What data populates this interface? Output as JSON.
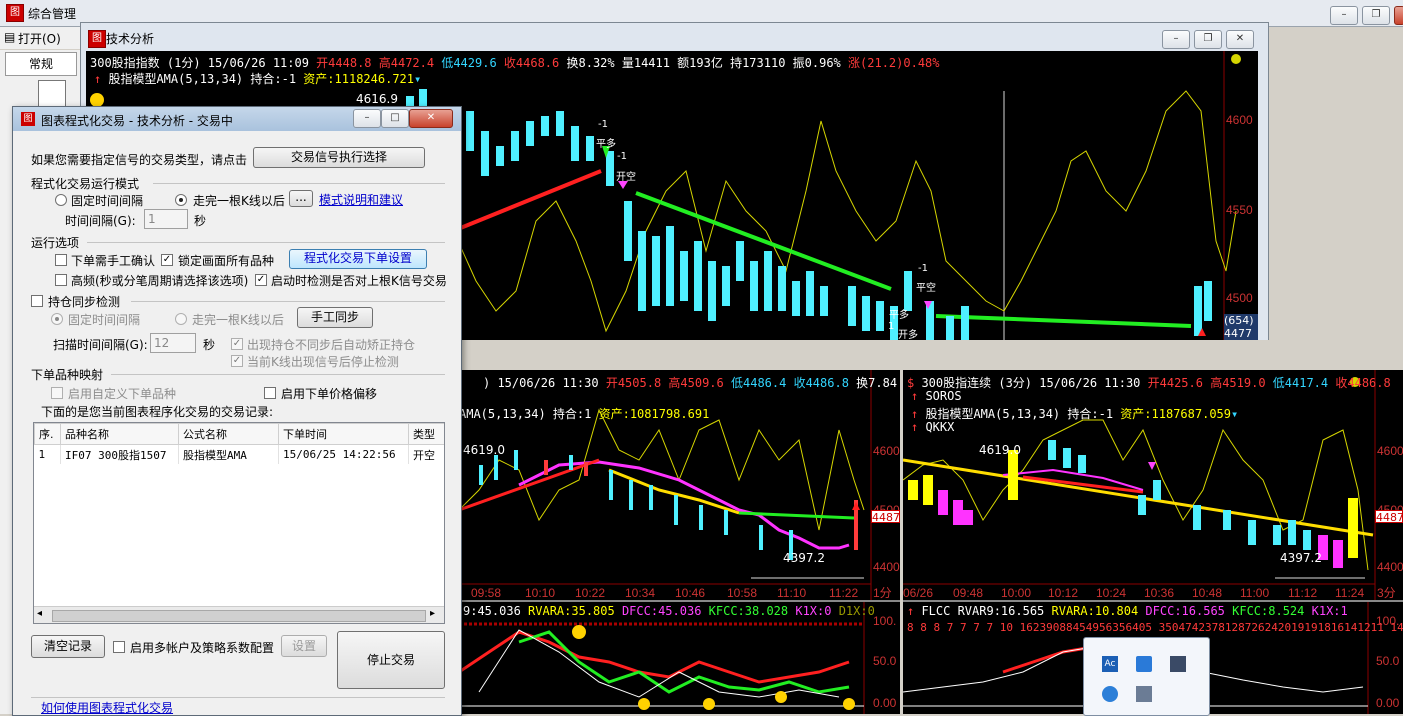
{
  "app": {
    "title": "综合管理",
    "menu_open": "打开(O)",
    "tab_general": "常规"
  },
  "ta_window": {
    "title": "技术分析"
  },
  "top_chart": {
    "line1": [
      {
        "text": "300股指指数 (1分) 15/06/26 11:09 ",
        "color": "#ffffff"
      },
      {
        "text": "开4448.8",
        "color": "#ff3b3b"
      },
      {
        "text": " 高4472.4",
        "color": "#ff3b3b"
      },
      {
        "text": " 低4429.6",
        "color": "#33d6ff"
      },
      {
        "text": " 收4468.6",
        "color": "#ff3b3b"
      },
      {
        "text": " 换8.32% 量14411 额193亿 持173110 振0.96% ",
        "color": "#ffffff"
      },
      {
        "text": "涨(21.2)0.48%",
        "color": "#ff3b3b"
      }
    ],
    "line2_model": "股指模型AMA(5,13,34) 持合:-1",
    "line2_assets": "资产:1118246.721",
    "y_labels": [
      "4600",
      "4550",
      "4500"
    ],
    "price_hi": "4616.9",
    "last_box": "(654)",
    "last_box2": "4477",
    "annotations": {
      "a1": "-1",
      "a2": "平多",
      "a3": "-1",
      "a4": "开空",
      "b1": "-1",
      "b2": "平空",
      "b3": "平多",
      "b4": "1",
      "b5": "开多",
      "b6": "1"
    }
  },
  "mid_left": {
    "header": [
      {
        "text": ") 15/06/26 11:30 ",
        "color": "#ffffff"
      },
      {
        "text": "开4505.8",
        "color": "#ff3b3b"
      },
      {
        "text": " 高4509.6",
        "color": "#ff3b3b"
      },
      {
        "text": " 低4486.4",
        "color": "#33d6ff"
      },
      {
        "text": " 收4486.8",
        "color": "#33d6ff"
      },
      {
        "text": " 换7.84",
        "color": "#ffffff"
      }
    ],
    "model": "AMA(5,13,34) 持合:1",
    "assets": "资产:1081798.691",
    "y_labels": [
      "4600",
      "4500",
      "4400"
    ],
    "y_right_unit": "1分",
    "price_hi": "4619.0",
    "price_lo": "4397.2",
    "last": "4487",
    "x_labels": [
      "09:58",
      "10:10",
      "10:22",
      "10:34",
      "10:46",
      "10:58",
      "11:10",
      "11:22"
    ]
  },
  "mid_right": {
    "header": [
      {
        "text": "300股指连续 (3分) 15/06/26 11:30 ",
        "color": "#ffffff"
      },
      {
        "text": "开4425.6",
        "color": "#ff3b3b"
      },
      {
        "text": " 高4519.0",
        "color": "#ff3b3b"
      },
      {
        "text": " 低4417.4",
        "color": "#33d6ff"
      },
      {
        "text": " 收4486.8",
        "color": "#ff3b3b"
      }
    ],
    "sub1": "SOROS",
    "sub2": "股指模型AMA(5,13,34) 持合:-1",
    "sub2_assets": "资产:1187687.059",
    "sub3": "QKKX",
    "y_labels": [
      "4600",
      "4500",
      "4400"
    ],
    "y_right_unit": "3分",
    "price_hi": "4619.0",
    "price_lo": "4397.2",
    "last": "4487",
    "x_labels": [
      "06/26",
      "09:48",
      "10:00",
      "10:12",
      "10:24",
      "10:36",
      "10:48",
      "11:00",
      "11:12",
      "11:24"
    ]
  },
  "bottom_left": {
    "header": [
      {
        "text": "9:45.036",
        "color": "#ffffff"
      },
      {
        "text": " RVARA:35.805",
        "color": "#ffff00"
      },
      {
        "text": " DFCC:45.036",
        "color": "#ff44ff"
      },
      {
        "text": " KFCC:38.028",
        "color": "#33ff33"
      },
      {
        "text": " K1X:0",
        "color": "#ff44ff"
      },
      {
        "text": " D1X:0",
        "color": "#999900"
      }
    ],
    "y_labels": [
      "100.",
      "50.0",
      "0.00"
    ]
  },
  "bottom_right": {
    "header": [
      {
        "text": "FLCC",
        "color": "#ffffff"
      },
      {
        "text": " RVAR9:16.565",
        "color": "#ffffff"
      },
      {
        "text": " RVARA:10.804",
        "color": "#ffff00"
      },
      {
        "text": " DFCC:16.565",
        "color": "#ff44ff"
      },
      {
        "text": " KFCC:8.524",
        "color": "#33ff33"
      },
      {
        "text": " K1X:1",
        "color": "#ff44ff"
      }
    ],
    "digits": "8 8 8 7 7 7 7 10 16239088454956356405 3504742378128726242019191816141211 14",
    "y_labels": [
      "100.",
      "50.0",
      "0.00"
    ]
  },
  "dialog": {
    "title": "图表程式化交易 - 技术分析 - 交易中",
    "prompt": "如果您需要指定信号的交易类型，请点击",
    "btn_signal": "交易信号执行选择",
    "mode_group": "程式化交易运行模式",
    "mode_fixed": "固定时间间隔",
    "mode_kline": "走完一根K线以后",
    "mode_dots": "...",
    "mode_link": "模式说明和建议",
    "interval_label": "时间间隔(G):",
    "interval_value": "1",
    "interval_unit": "秒",
    "options_group": "运行选项",
    "opt_manual": "下单需手工确认",
    "opt_lock": "锁定画面所有品种",
    "btn_order_setting": "程式化交易下单设置",
    "opt_hf": "高频(秒或分笔周期请选择该选项)",
    "opt_start_check": "启动时检测是否对上根K信号交易",
    "sync_group": "持仓同步检测",
    "sync_fixed": "固定时间间隔",
    "sync_kline": "走完一根K线以后",
    "btn_manual_sync": "手工同步",
    "scan_label": "扫描时间间隔(G):",
    "scan_value": "12",
    "scan_unit": "秒",
    "sync_auto_fix": "出现持仓不同步后自动矫正持仓",
    "sync_stop": "当前K线出现信号后停止检测",
    "map_group": "下单品种映射",
    "map_custom": "启用自定义下单品种",
    "map_offset": "启用下单价格偏移",
    "records_label": "下面的是您当前图表程序化交易的交易记录:",
    "columns": [
      "序.",
      "品种名称",
      "公式名称",
      "下单时间",
      "类型"
    ],
    "rows": [
      [
        "1",
        "IF07 300股指1507",
        "股指模型AMA",
        "15/06/25 14:22:56",
        "开空"
      ]
    ],
    "btn_clear": "清空记录",
    "opt_multi": "启用多帐户及策略系数配置",
    "btn_settings": "设置",
    "btn_stop": "停止交易",
    "help_link": "如何使用图表程式化交易"
  },
  "colors": {
    "up": "#ff3b3b",
    "down": "#4ff0ff",
    "bg": "#000000",
    "grid": "#8b0000"
  }
}
